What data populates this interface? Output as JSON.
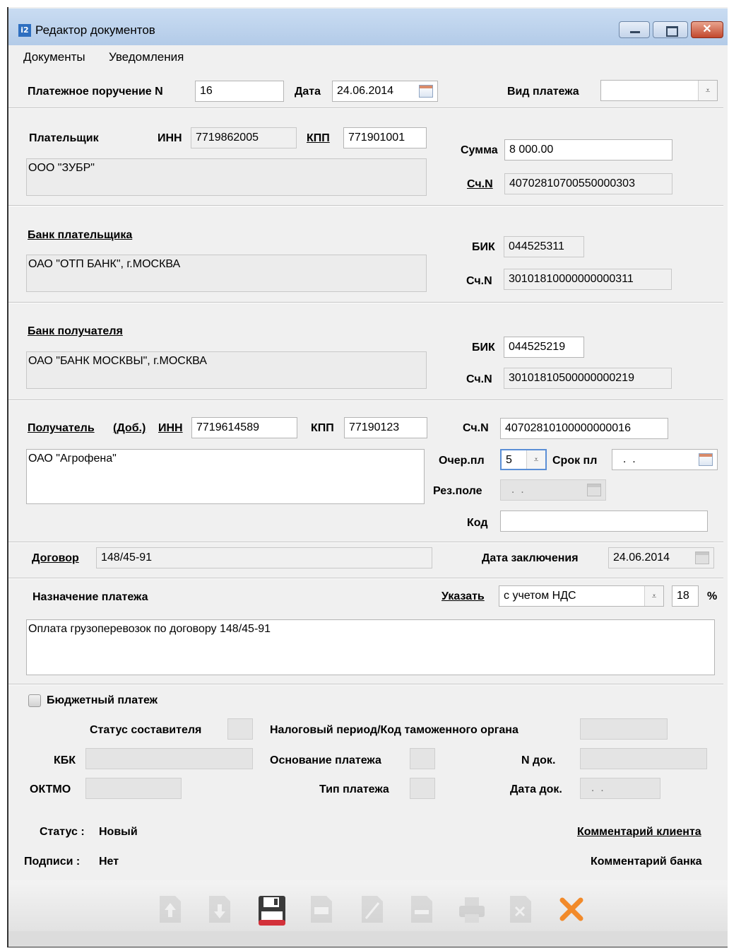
{
  "window": {
    "title": "Редактор документов",
    "app_icon": "i2-app-icon"
  },
  "menu": [
    "Документы",
    "Уведомления"
  ],
  "header": {
    "doc_label": "Платежное поручение N",
    "doc_number": "16",
    "date_label": "Дата",
    "date_value": "24.06.2014",
    "payment_type_label": "Вид платежа",
    "payment_type_value": ""
  },
  "payer": {
    "label": "Плательщик",
    "inn_label": "ИНН",
    "inn": "7719862005",
    "kpp_label": "КПП",
    "kpp": "771901001",
    "name": "ООО \"ЗУБР\"",
    "sum_label": "Сумма",
    "sum": "8 000.00",
    "account_label": "Сч.N",
    "account": "40702810700550000303"
  },
  "payer_bank": {
    "label": "Банк плательщика",
    "name": "ОАО \"ОТП БАНК\", г.МОСКВА",
    "bik_label": "БИК",
    "bik": "044525311",
    "account_label": "Сч.N",
    "account": "30101810000000000311"
  },
  "recipient_bank": {
    "label": "Банк получателя",
    "name": "ОАО \"БАНК МОСКВЫ\", г.МОСКВА",
    "bik_label": "БИК",
    "bik": "044525219",
    "account_label": "Сч.N",
    "account": "30101810500000000219"
  },
  "recipient": {
    "label": "Получатель",
    "extra_label": "(Доб.)",
    "inn_label": "ИНН",
    "inn": "7719614589",
    "kpp_label": "КПП",
    "kpp": "77190123",
    "account_label": "Сч.N",
    "account": "40702810100000000016",
    "name": "ОАО \"Агрофена\"",
    "priority_label": "Очер.пл",
    "priority": "5",
    "term_label": "Срок пл",
    "term": "  .  .",
    "reserve_label": "Рез.поле",
    "reserve": "  .  .",
    "code_label": "Код",
    "code": ""
  },
  "contract": {
    "label": "Договор",
    "value": "148/45-91",
    "date_label": "Дата заключения",
    "date": "24.06.2014"
  },
  "purpose": {
    "label": "Назначение платежа",
    "specify_label": "Указать",
    "vat_option": "с учетом НДС",
    "vat_rate": "18",
    "percent": "%",
    "text": "Оплата грузоперевозок по договору 148/45-91"
  },
  "budget": {
    "checkbox_label": "Бюджетный платеж",
    "status_label": "Статус составителя",
    "tax_period_label": "Налоговый период/Код таможенного органа",
    "kbk_label": "КБК",
    "basis_label": "Основание платежа",
    "doc_no_label": "N док.",
    "oktmo_label": "ОКТМО",
    "pay_type_label": "Тип платежа",
    "doc_date_label": "Дата док.",
    "doc_date": "  .  ."
  },
  "status": {
    "status_label": "Статус :",
    "status_value": "Новый",
    "signs_label": "Подписи :",
    "signs_value": "Нет",
    "client_comment": "Комментарий клиента",
    "bank_comment": "Комментарий банка"
  },
  "toolbar": [
    "up-arrow-icon",
    "down-arrow-icon",
    "save-icon",
    "document-icon",
    "edit-icon",
    "copy-icon",
    "print-icon",
    "delete-doc-icon",
    "close-x-icon"
  ],
  "colors": {
    "titlebar": "#b9d0ec",
    "close_button": "#c9482d",
    "save_icon": "#d3313a",
    "cancel_icon": "#f28a2a"
  }
}
